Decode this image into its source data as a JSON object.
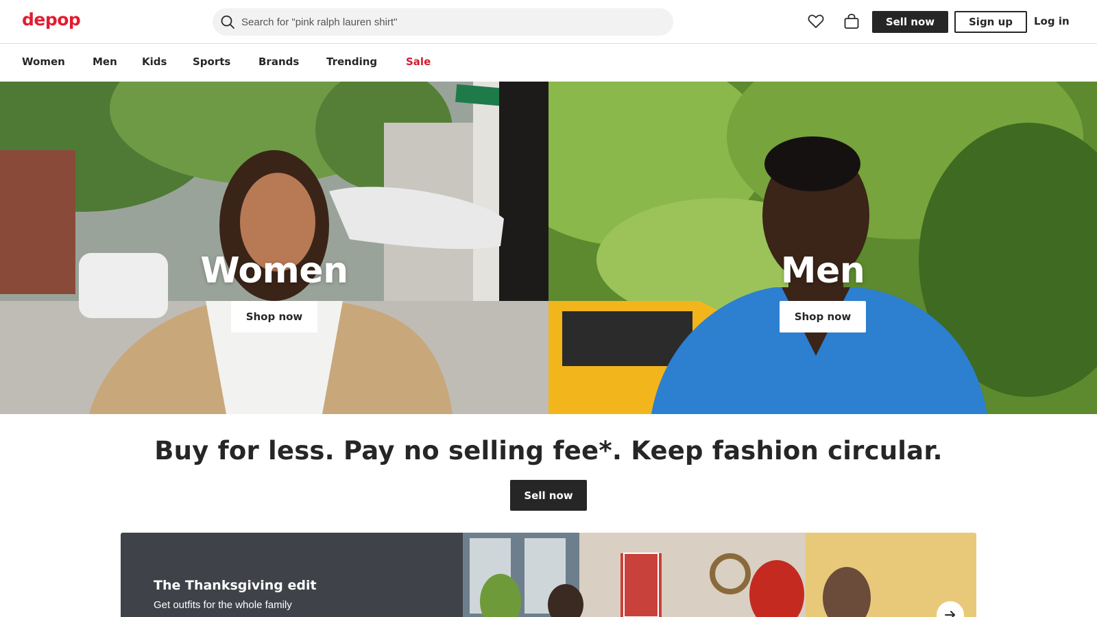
{
  "header": {
    "logo_text": "depop",
    "logo_color": "#e41b2f",
    "search": {
      "placeholder": "Search for \"pink ralph lauren shirt\"",
      "value": "",
      "icon": "search-icon"
    },
    "icons": [
      "heart-icon",
      "bag-icon"
    ],
    "sell_now_label": "Sell now",
    "sign_up_label": "Sign up",
    "log_in_label": "Log in"
  },
  "nav": {
    "items": [
      {
        "label": "Women"
      },
      {
        "label": "Men"
      },
      {
        "label": "Kids"
      },
      {
        "label": "Sports"
      },
      {
        "label": "Brands"
      },
      {
        "label": "Trending"
      },
      {
        "label": "Sale",
        "color": "#d21b2e"
      }
    ]
  },
  "hero": {
    "panels": [
      {
        "title": "Women",
        "button_label": "Shop now"
      },
      {
        "title": "Men",
        "button_label": "Shop now"
      }
    ]
  },
  "promo": {
    "tagline": "Buy for less. Pay no selling fee*. Keep fashion circular.",
    "button_label": "Sell now"
  },
  "banner": {
    "title": "The Thanksgiving edit",
    "subtitle": "Get outfits for the whole family",
    "next_icon": "arrow-right-icon"
  },
  "colors": {
    "brand": "#e41b2f",
    "dark_button": "#262626",
    "banner_panel": "#404249"
  }
}
